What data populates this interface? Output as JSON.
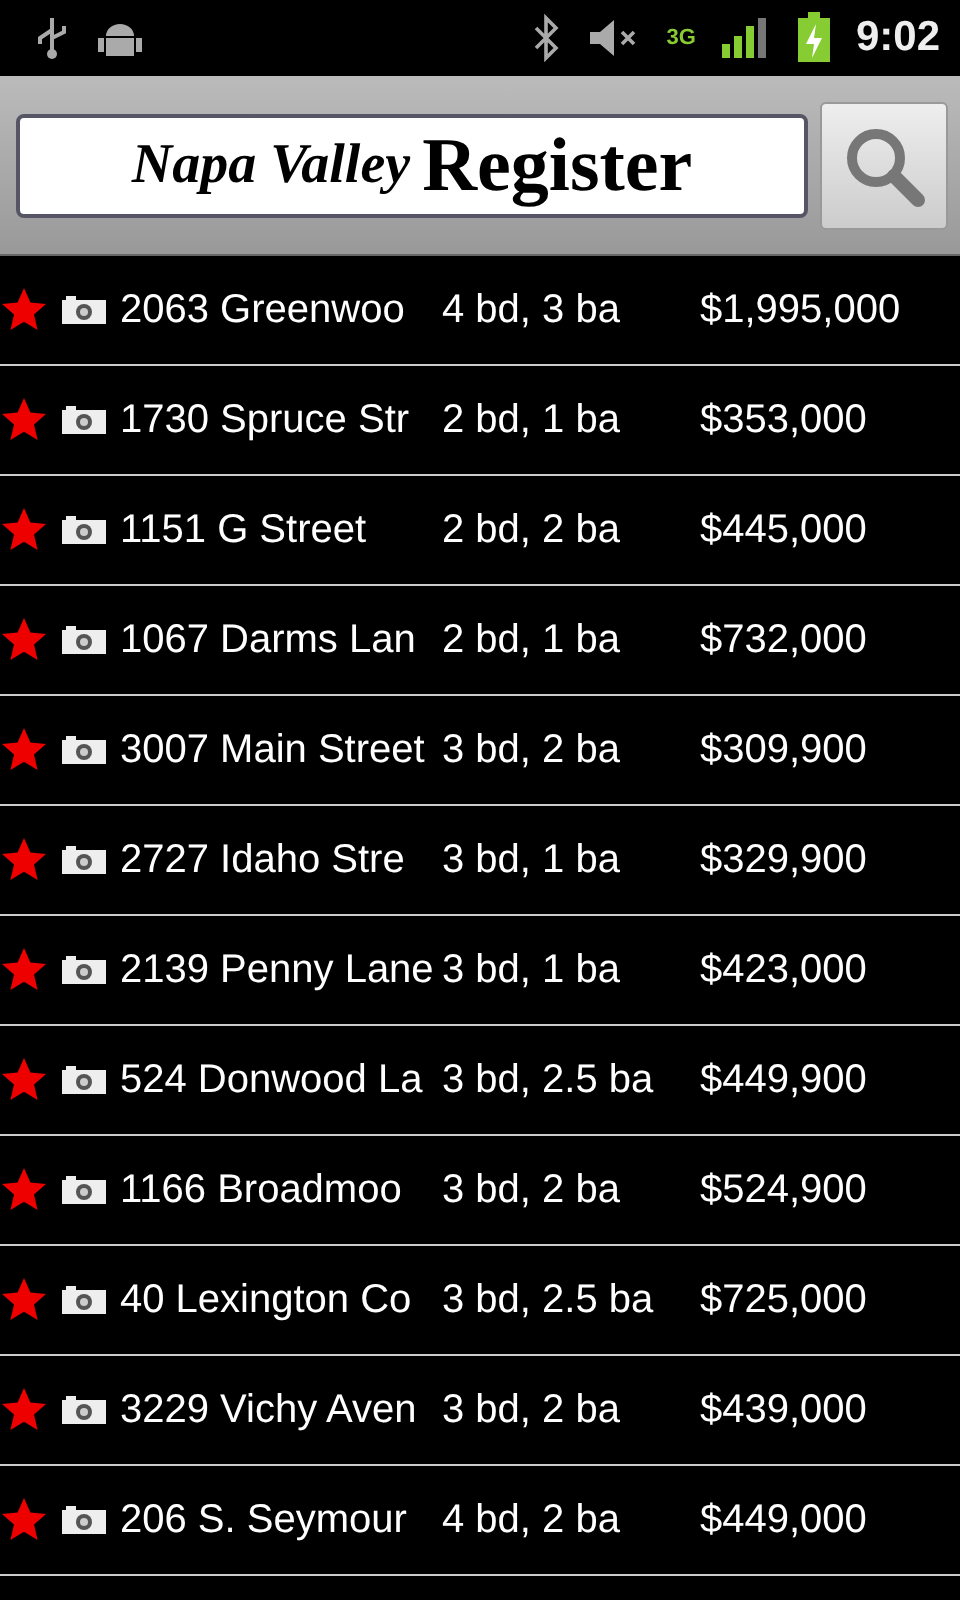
{
  "status_bar": {
    "network_type": "3G",
    "time": "9:02"
  },
  "header": {
    "logo_left": "Napa Valley",
    "logo_right": "Register"
  },
  "listings": [
    {
      "address": "2063 Greenwoo",
      "rooms": "4 bd, 3 ba",
      "price": "$1,995,000"
    },
    {
      "address": "1730 Spruce Str",
      "rooms": "2 bd, 1 ba",
      "price": "$353,000"
    },
    {
      "address": "1151 G Street",
      "rooms": "2 bd, 2 ba",
      "price": "$445,000"
    },
    {
      "address": "1067 Darms Lan",
      "rooms": "2 bd, 1 ba",
      "price": "$732,000"
    },
    {
      "address": "3007 Main Street",
      "rooms": "3 bd, 2 ba",
      "price": "$309,900"
    },
    {
      "address": "2727 Idaho Stre",
      "rooms": "3 bd, 1 ba",
      "price": "$329,900"
    },
    {
      "address": "2139 Penny Lane",
      "rooms": "3 bd, 1 ba",
      "price": "$423,000"
    },
    {
      "address": "524 Donwood La",
      "rooms": "3 bd, 2.5 ba",
      "price": "$449,900"
    },
    {
      "address": "1166 Broadmoo",
      "rooms": "3 bd, 2 ba",
      "price": "$524,900"
    },
    {
      "address": "40 Lexington Co",
      "rooms": "3 bd, 2.5 ba",
      "price": "$725,000"
    },
    {
      "address": "3229 Vichy Aven",
      "rooms": "3 bd, 2 ba",
      "price": "$439,000"
    },
    {
      "address": "206 S. Seymour",
      "rooms": "4 bd, 2 ba",
      "price": "$449,000"
    }
  ]
}
